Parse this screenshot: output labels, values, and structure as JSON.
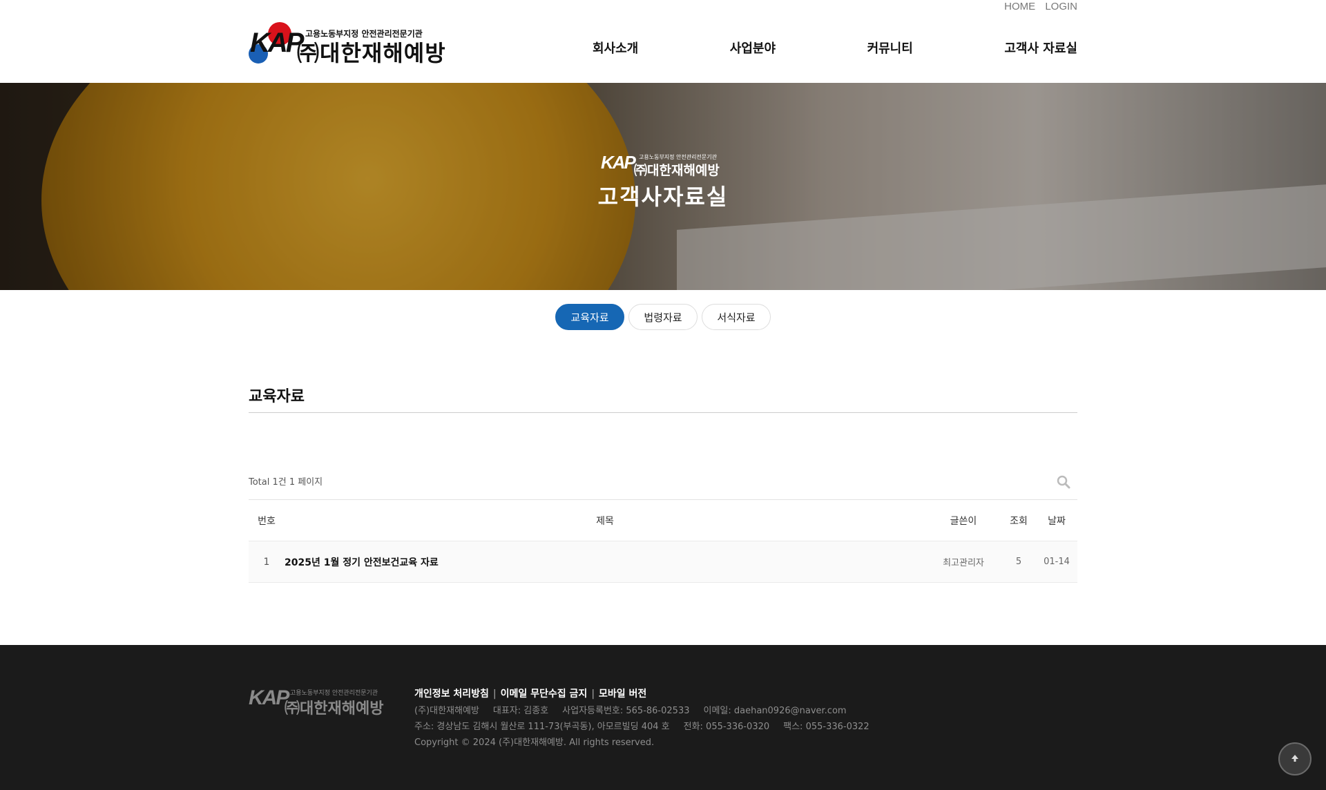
{
  "header": {
    "top_links": {
      "home": "HOME",
      "login": "LOGIN"
    },
    "logo": {
      "mark": "KAP",
      "tagline": "고용노동부지정 안전관리전문기관",
      "name": "㈜대한재해예방"
    },
    "nav": [
      "회사소개",
      "사업분야",
      "커뮤니티",
      "고객사 자료실"
    ]
  },
  "hero": {
    "logo": {
      "mark": "KAP",
      "tagline": "고용노동부지정 안전관리전문기관",
      "name": "㈜대한재해예방"
    },
    "title": "고객사자료실"
  },
  "tabs": [
    {
      "label": "교육자료",
      "active": true
    },
    {
      "label": "법령자료",
      "active": false
    },
    {
      "label": "서식자료",
      "active": false
    }
  ],
  "board": {
    "title": "교육자료",
    "total_text": "Total 1건 1 페이지",
    "columns": {
      "num": "번호",
      "title": "제목",
      "author": "글쓴이",
      "views": "조회",
      "date": "날짜"
    },
    "rows": [
      {
        "num": "1",
        "title": "2025년 1월 정기 안전보건교육 자료",
        "author": "최고관리자",
        "views": "5",
        "date": "01-14"
      }
    ]
  },
  "footer": {
    "logo": {
      "mark": "KAP",
      "tagline": "고용노동부지정 안전관리전문기관",
      "name": "㈜대한재해예방"
    },
    "links": [
      "개인정보 처리방침",
      "이메일 무단수집 금지",
      "모바일 버전"
    ],
    "line1": [
      "(주)대한재해예방",
      "대표자: 김종호",
      "사업자등록번호: 565-86-02533",
      "이메일: daehan0926@naver.com"
    ],
    "line2": [
      "주소: 경상남도 김해시 월산로 111-73(부곡동), 아모르빌딩 404 호",
      "전화: 055-336-0320",
      "팩스: 055-336-0322"
    ],
    "copyright": "Copyright © 2024 (주)대한재해예방. All rights reserved."
  },
  "colors": {
    "accent": "#1667b4",
    "footer_bg": "#1b1b1b"
  },
  "icons": {
    "search": "search-icon",
    "scroll_top": "arrow-up-icon"
  }
}
